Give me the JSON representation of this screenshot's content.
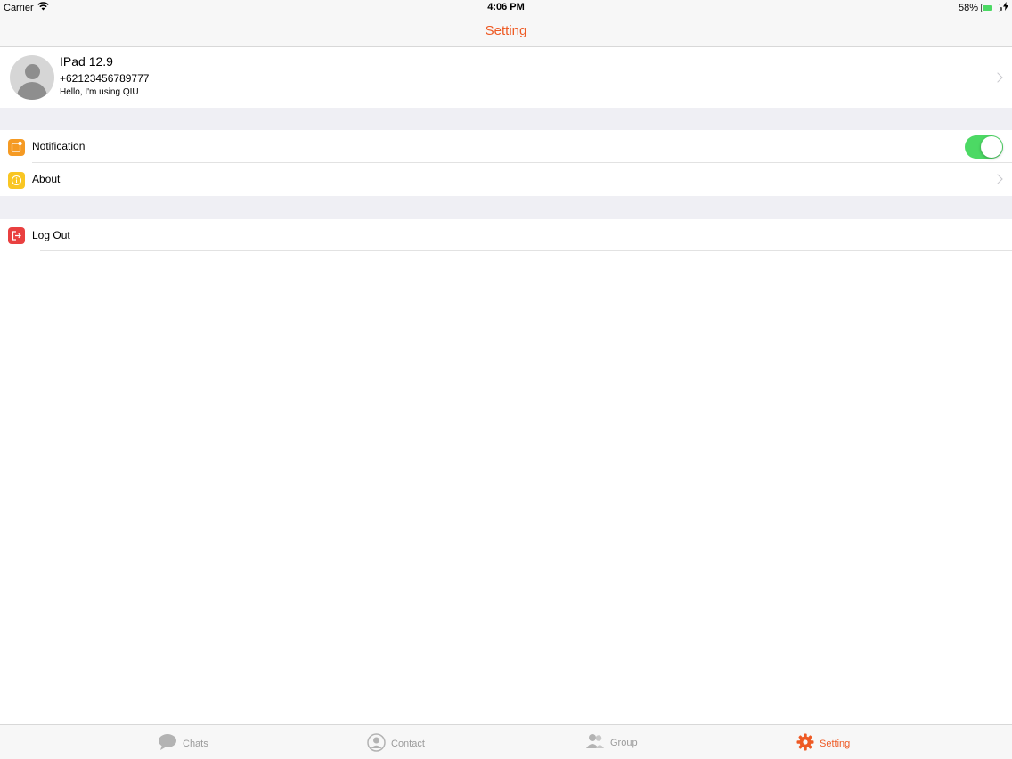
{
  "status_bar": {
    "carrier": "Carrier",
    "time": "4:06 PM",
    "battery": "58%",
    "battery_level": 0.58
  },
  "nav": {
    "title": "Setting"
  },
  "profile": {
    "name": "IPad 12.9",
    "phone": "+62123456789777",
    "status": "Hello, I'm using QIU"
  },
  "rows": [
    {
      "label": "Notification",
      "icon": "notification-icon",
      "color": "#f59a23",
      "toggle": true
    },
    {
      "label": "About",
      "icon": "info-icon",
      "color": "#f9c623"
    },
    {
      "label": "Log Out",
      "icon": "logout-icon",
      "color": "#e94040"
    }
  ],
  "tabs": [
    {
      "label": "Chats",
      "icon": "chat-bubble-icon",
      "active": false
    },
    {
      "label": "Contact",
      "icon": "contact-icon",
      "active": false
    },
    {
      "label": "Group",
      "icon": "group-icon",
      "active": false
    },
    {
      "label": "Setting",
      "icon": "gear-icon",
      "active": true
    }
  ],
  "colors": {
    "accent": "#ee5a24",
    "toggle_on": "#4cd964",
    "separator_bg": "#efeff4"
  }
}
